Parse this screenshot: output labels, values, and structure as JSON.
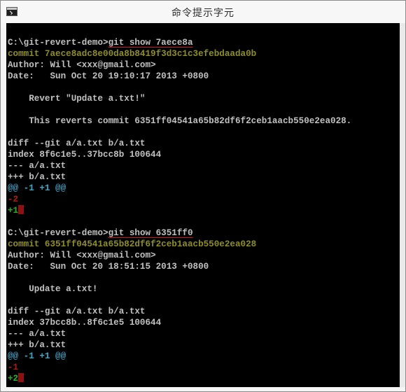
{
  "window": {
    "title": "命令提示字元",
    "icon": "cmd-icon"
  },
  "console": {
    "lines": [
      {
        "prompt": "C:\\git-revert-demo>",
        "command": "git show 7aece8a"
      },
      {
        "text": "commit 7aece8adc8e00da8b8419f3d3c1c3efebdaada0b"
      },
      {
        "text": "Author: Will <xxx@gmail.com>"
      },
      {
        "text": "Date:   Sun Oct 20 19:10:17 2013 +0800"
      },
      {
        "text": ""
      },
      {
        "text": "    Revert \"Update a.txt!\""
      },
      {
        "text": ""
      },
      {
        "text": "    This reverts commit 6351ff04541a65b82df6f2ceb1aacb550e2ea028."
      },
      {
        "text": ""
      },
      {
        "text": "diff --git a/a.txt b/a.txt"
      },
      {
        "text": "index 8f6c1e5..37bcc8b 100644"
      },
      {
        "text": "--- a/a.txt"
      },
      {
        "text": "+++ b/a.txt"
      },
      {
        "text": "@@ -1 +1 @@"
      },
      {
        "text": "-2"
      },
      {
        "text": "+1"
      },
      {
        "text": ""
      },
      {
        "prompt": "C:\\git-revert-demo>",
        "command": "git show 6351ff0"
      },
      {
        "text": "commit 6351ff04541a65b82df6f2ceb1aacb550e2ea028"
      },
      {
        "text": "Author: Will <xxx@gmail.com>"
      },
      {
        "text": "Date:   Sun Oct 20 18:51:15 2013 +0800"
      },
      {
        "text": ""
      },
      {
        "text": "    Update a.txt!"
      },
      {
        "text": ""
      },
      {
        "text": "diff --git a/a.txt b/a.txt"
      },
      {
        "text": "index 37bcc8b..8f6c1e5 100644"
      },
      {
        "text": "--- a/a.txt"
      },
      {
        "text": "+++ b/a.txt"
      },
      {
        "text": "@@ -1 +1 @@"
      },
      {
        "text": "-1"
      },
      {
        "text": "+2"
      }
    ]
  },
  "colors": {
    "background": "#000000",
    "text": "#c0c0c0",
    "commit": "#8f8f1c",
    "hunk": "#3aa6c9",
    "removed": "#b31818",
    "added": "#22b422",
    "annotation": "#d01414"
  }
}
